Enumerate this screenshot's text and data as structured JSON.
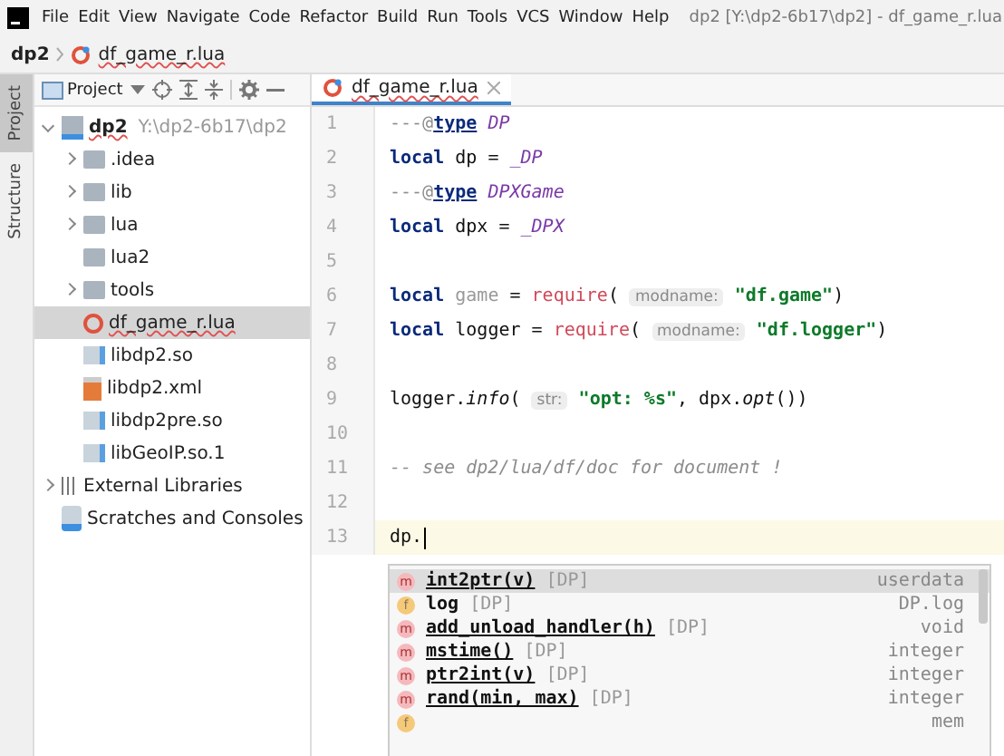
{
  "menu": [
    "File",
    "Edit",
    "View",
    "Navigate",
    "Code",
    "Refactor",
    "Build",
    "Run",
    "Tools",
    "VCS",
    "Window",
    "Help"
  ],
  "window": {
    "title": "dp2 [Y:\\dp2-6b17\\dp2] - df_game_r.lua"
  },
  "breadcrumb": [
    "dp2",
    "df_game_r.lua"
  ],
  "side_tabs": [
    {
      "label": "Project",
      "selected": true
    },
    {
      "label": "Structure",
      "selected": false
    }
  ],
  "project_panel": {
    "title": "Project"
  },
  "tree": [
    {
      "label": "dp2",
      "path": "Y:\\dp2-6b17\\dp2",
      "kind": "module",
      "expanded": true,
      "selected": false,
      "children": [
        {
          "label": ".idea",
          "kind": "folder",
          "expanded": false,
          "selected": false
        },
        {
          "label": "lib",
          "kind": "folder",
          "expanded": false,
          "selected": false
        },
        {
          "label": "lua",
          "kind": "folder",
          "expanded": false,
          "selected": false
        },
        {
          "label": "lua2",
          "kind": "folder",
          "selected": false
        },
        {
          "label": "tools",
          "kind": "folder",
          "expanded": false,
          "selected": false
        },
        {
          "label": "df_game_r.lua",
          "kind": "lua",
          "selected": true
        },
        {
          "label": "libdp2.so",
          "kind": "file",
          "selected": false
        },
        {
          "label": "libdp2.xml",
          "kind": "xml",
          "selected": false
        },
        {
          "label": "libdp2pre.so",
          "kind": "file",
          "selected": false
        },
        {
          "label": "libGeoIP.so.1",
          "kind": "file",
          "selected": false
        }
      ]
    },
    {
      "label": "External Libraries",
      "kind": "libs",
      "expanded": false,
      "selected": false
    },
    {
      "label": "Scratches and Consoles",
      "kind": "scratch",
      "selected": false
    }
  ],
  "editor_tab": {
    "label": "df_game_r.lua",
    "selected": true
  },
  "code": [
    {
      "number": "1",
      "tokens": [
        {
          "kind": "comment",
          "text": "---@"
        },
        {
          "kind": "tag",
          "text": "type"
        },
        {
          "kind": "typeref",
          "text": " DP"
        }
      ]
    },
    {
      "number": "2",
      "tokens": [
        {
          "kind": "keyword",
          "text": "local"
        },
        {
          "kind": "plain",
          "text": " dp = "
        },
        {
          "kind": "typeref",
          "text": "_DP"
        }
      ]
    },
    {
      "number": "3",
      "tokens": [
        {
          "kind": "comment",
          "text": "---@"
        },
        {
          "kind": "tag",
          "text": "type"
        },
        {
          "kind": "typeref",
          "text": " DPXGame"
        }
      ]
    },
    {
      "number": "4",
      "tokens": [
        {
          "kind": "keyword",
          "text": "local"
        },
        {
          "kind": "plain",
          "text": " dpx = "
        },
        {
          "kind": "typeref",
          "text": "_DPX"
        }
      ]
    },
    {
      "number": "5"
    },
    {
      "number": "6",
      "tokens": [
        {
          "kind": "keyword",
          "text": "local"
        },
        {
          "kind": "unused",
          "text": " game"
        },
        {
          "kind": "plain",
          "text": " = "
        },
        {
          "kind": "call",
          "text": "require"
        },
        {
          "kind": "plain",
          "text": "( "
        },
        {
          "kind": "hint",
          "text": "modname:"
        },
        {
          "kind": "string",
          "text": " \"df.game\""
        },
        {
          "kind": "plain",
          "text": ")"
        }
      ]
    },
    {
      "number": "7",
      "tokens": [
        {
          "kind": "keyword",
          "text": "local"
        },
        {
          "kind": "plain",
          "text": " logger = "
        },
        {
          "kind": "call",
          "text": "require"
        },
        {
          "kind": "plain",
          "text": "( "
        },
        {
          "kind": "hint",
          "text": "modname:"
        },
        {
          "kind": "string",
          "text": " \"df.logger\""
        },
        {
          "kind": "plain",
          "text": ")"
        }
      ]
    },
    {
      "number": "8"
    },
    {
      "number": "9",
      "tokens": [
        {
          "kind": "plain",
          "text": "logger."
        },
        {
          "kind": "method",
          "text": "info"
        },
        {
          "kind": "plain",
          "text": "( "
        },
        {
          "kind": "hint",
          "text": "str:"
        },
        {
          "kind": "string",
          "text": " \"opt: %s\""
        },
        {
          "kind": "plain",
          "text": ", dpx."
        },
        {
          "kind": "method",
          "text": "opt"
        },
        {
          "kind": "plain",
          "text": "())"
        }
      ]
    },
    {
      "number": "10"
    },
    {
      "number": "11",
      "tokens": [
        {
          "kind": "linecomment",
          "text": "-- see dp2/lua/df/doc for document !"
        }
      ]
    },
    {
      "number": "12"
    },
    {
      "number": "13",
      "current": true,
      "tokens": [
        {
          "kind": "plain",
          "text": "dp."
        }
      ]
    }
  ],
  "completion": [
    {
      "kind": "m",
      "name": "int2ptr(v)",
      "owner": "[DP]",
      "type": "userdata",
      "selected": true
    },
    {
      "kind": "f",
      "name": "log",
      "owner": "[DP]",
      "type": "DP.log",
      "selected": false
    },
    {
      "kind": "m",
      "name": "add_unload_handler(h)",
      "owner": "[DP]",
      "type": "void",
      "selected": false
    },
    {
      "kind": "m",
      "name": "mstime()",
      "owner": "[DP]",
      "type": "integer",
      "selected": false
    },
    {
      "kind": "m",
      "name": "ptr2int(v)",
      "owner": "[DP]",
      "type": "integer",
      "selected": false
    },
    {
      "kind": "m",
      "name": "rand(min, max)",
      "owner": "[DP]",
      "type": "integer",
      "selected": false
    },
    {
      "kind": "f",
      "type": "mem",
      "selected": false
    }
  ]
}
